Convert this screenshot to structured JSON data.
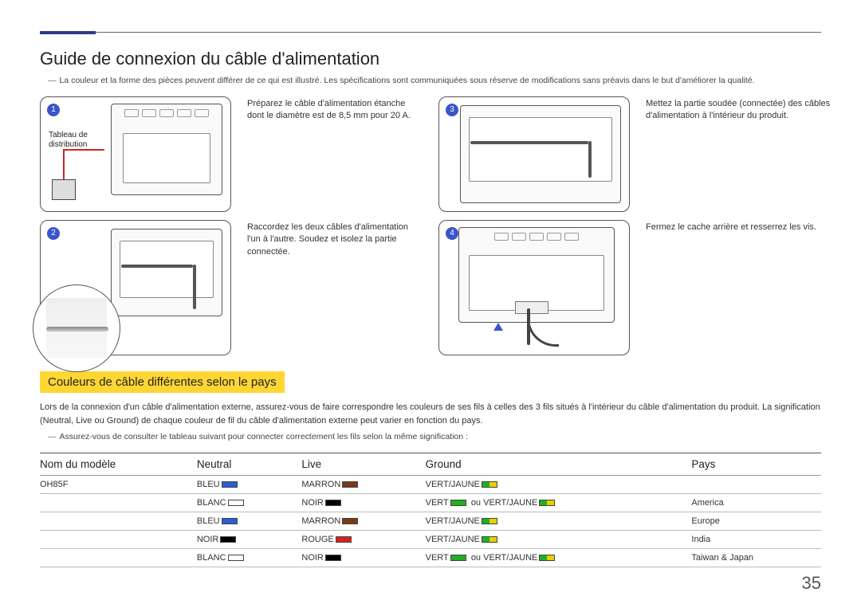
{
  "title": "Guide de connexion du câble d'alimentation",
  "disclaimer": "La couleur et la forme des pièces peuvent différer de ce qui est illustré. Les spécifications sont communiquées sous réserve de modifications sans préavis dans le but d'améliorer la qualité.",
  "steps": {
    "s1": {
      "num": "1",
      "label": "Tableau de\ndistribution",
      "text": "Préparez le câble d'alimentation étanche dont le diamètre est de 8,5 mm pour 20 A."
    },
    "s2": {
      "num": "2",
      "text": "Raccordez les deux câbles d'alimentation l'un à l'autre. Soudez et isolez la partie connectée."
    },
    "s3": {
      "num": "3",
      "text": "Mettez la partie soudée (connectée) des câbles d'alimentation à l'intérieur du produit."
    },
    "s4": {
      "num": "4",
      "text": "Fermez le cache arrière et resserrez les vis."
    }
  },
  "subhead": "Couleurs de câble différentes selon le pays",
  "intro_text": "Lors de la connexion d'un câble d'alimentation externe, assurez-vous de faire correspondre les couleurs de ses fils à celles des 3 fils situés à l'intérieur du câble d'alimentation du produit. La signification (Neutral, Live ou Ground) de chaque couleur de fil du câble d'alimentation externe peut varier en fonction du pays.",
  "intro_note": "Assurez-vous de consulter le tableau suivant pour connecter correctement les fils selon la même signification :",
  "table": {
    "headers": {
      "model": "Nom du modèle",
      "neutral": "Neutral",
      "live": "Live",
      "ground": "Ground",
      "country": "Pays"
    },
    "labels": {
      "BLEU": "BLEU",
      "BLANC": "BLANC",
      "NOIR": "NOIR",
      "MARRON": "MARRON",
      "ROUGE": "ROUGE",
      "VERT": "VERT",
      "VERTJAUNE": "VERT/JAUNE",
      "ou": "ou"
    },
    "rows": [
      {
        "model": "OH85F",
        "neutral": "BLEU",
        "live": "MARRON",
        "ground": "VERT/JAUNE",
        "country": ""
      },
      {
        "model": "",
        "neutral": "BLANC",
        "live": "NOIR",
        "ground": "VERT ou VERT/JAUNE",
        "country": "America"
      },
      {
        "model": "",
        "neutral": "BLEU",
        "live": "MARRON",
        "ground": "VERT/JAUNE",
        "country": "Europe"
      },
      {
        "model": "",
        "neutral": "NOIR",
        "live": "ROUGE",
        "ground": "VERT/JAUNE",
        "country": "India"
      },
      {
        "model": "",
        "neutral": "BLANC",
        "live": "NOIR",
        "ground": "VERT ou VERT/JAUNE",
        "country": "Taiwan & Japan"
      }
    ]
  },
  "page_number": "35"
}
